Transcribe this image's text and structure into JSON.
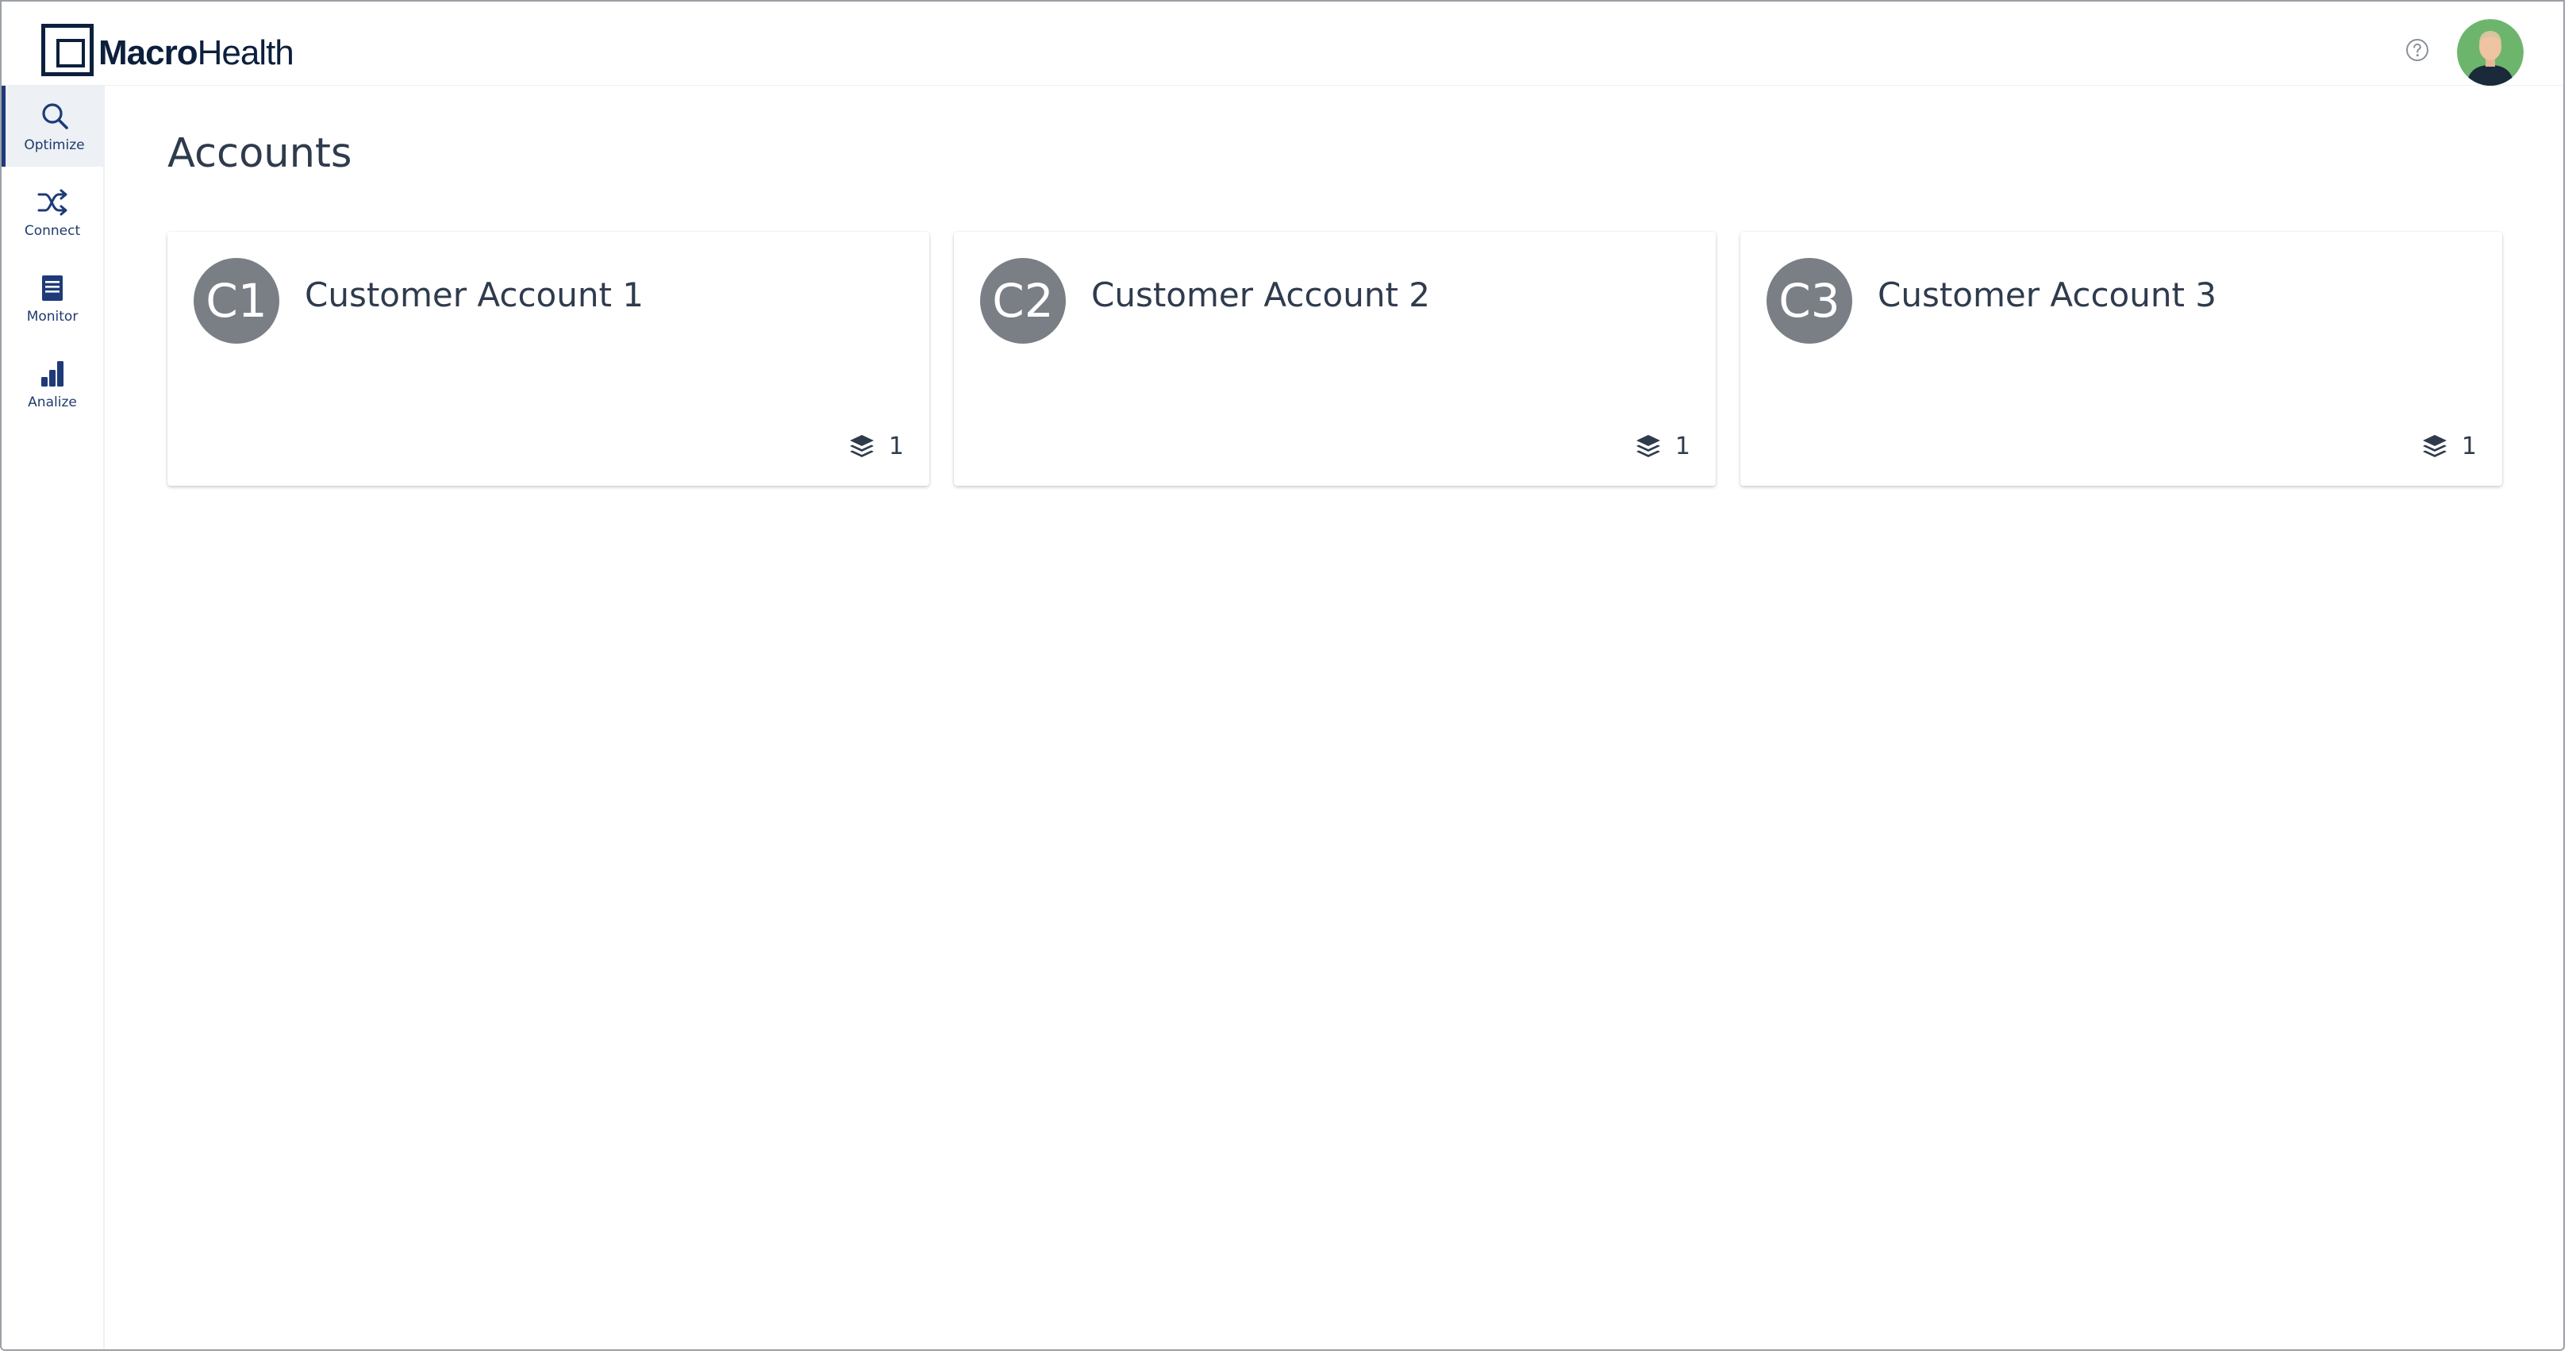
{
  "brand": {
    "name_bold": "Macro",
    "name_light": "Health"
  },
  "header": {
    "help_icon": "question-circle-icon",
    "avatar": "user-avatar"
  },
  "sidebar": {
    "items": [
      {
        "label": "Optimize",
        "icon": "search-icon",
        "active": true
      },
      {
        "label": "Connect",
        "icon": "shuffle-icon",
        "active": false
      },
      {
        "label": "Monitor",
        "icon": "list-icon",
        "active": false
      },
      {
        "label": "Analize",
        "icon": "bar-chart-icon",
        "active": false
      }
    ]
  },
  "main": {
    "title": "Accounts",
    "accounts": [
      {
        "initials": "C1",
        "name": "Customer Account 1",
        "count": "1",
        "icon": "layers-icon"
      },
      {
        "initials": "C2",
        "name": "Customer Account 2",
        "count": "1",
        "icon": "layers-icon"
      },
      {
        "initials": "C3",
        "name": "Customer Account 3",
        "count": "1",
        "icon": "layers-icon"
      }
    ]
  },
  "colors": {
    "brand_navy": "#0c1f3d",
    "nav_blue": "#1e3a78",
    "avatar_gray": "#7a7f86",
    "text": "#2f3b4d"
  }
}
